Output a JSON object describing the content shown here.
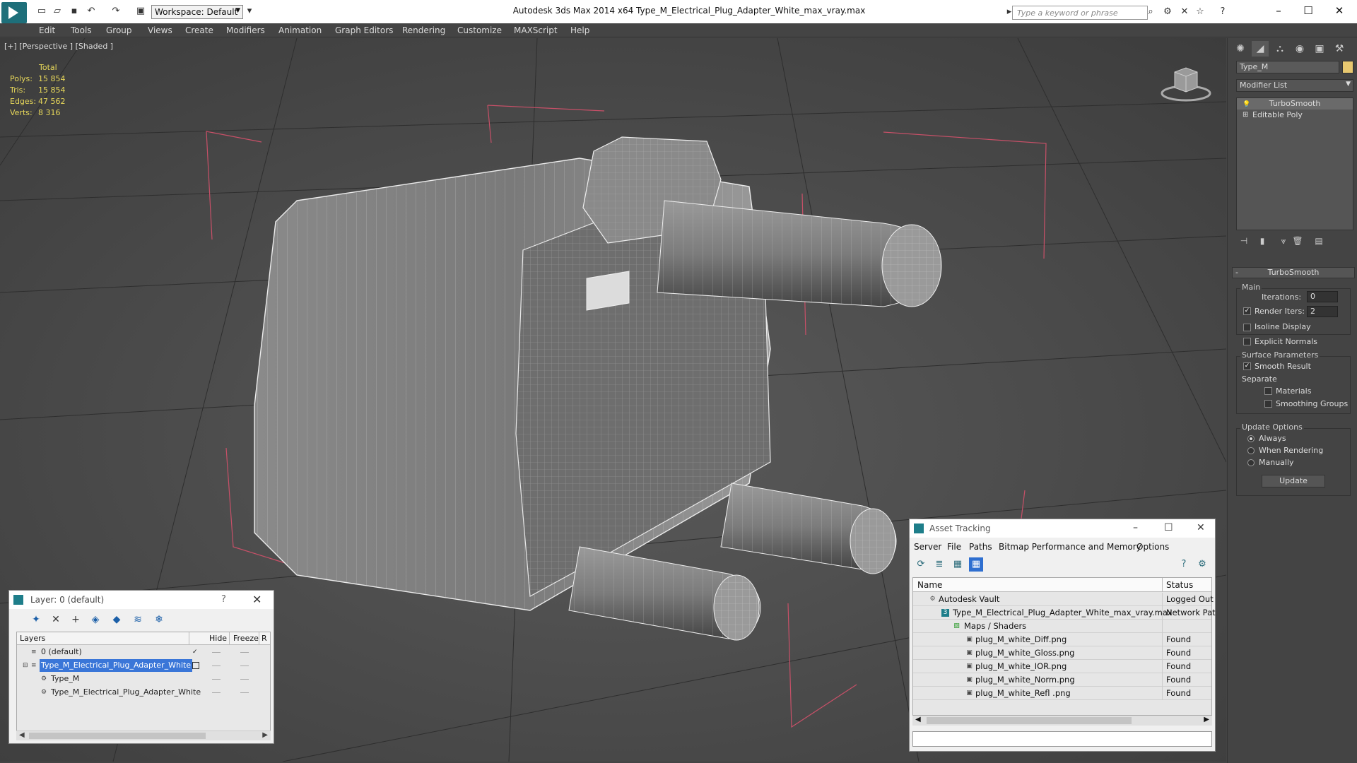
{
  "titlebar": {
    "workspace": "Workspace: Default",
    "title": "Autodesk 3ds Max  2014 x64      Type_M_Electrical_Plug_Adapter_White_max_vray.max",
    "search_placeholder": "Type a keyword or phrase"
  },
  "menu": [
    "Edit",
    "Tools",
    "Group",
    "Views",
    "Create",
    "Modifiers",
    "Animation",
    "Graph Editors",
    "Rendering",
    "Customize",
    "MAXScript",
    "Help"
  ],
  "viewport": {
    "label": "[+] [Perspective ] [Shaded ]",
    "stats": {
      "total": "Total",
      "rows": [
        {
          "label": "Polys:",
          "value": "15 854"
        },
        {
          "label": "Tris:",
          "value": "15 854"
        },
        {
          "label": "Edges:",
          "value": "47 562"
        },
        {
          "label": "Verts:",
          "value": "8 316"
        }
      ]
    }
  },
  "command_panel": {
    "object_name": "Type_M",
    "object_color": "#e8c870",
    "modifier_list": "Modifier List",
    "stack": [
      "TurboSmooth",
      "Editable Poly"
    ],
    "turbosmooth": {
      "title": "TurboSmooth",
      "main": "Main",
      "iterations_label": "Iterations:",
      "iterations_value": "0",
      "render_iters_label": "Render Iters:",
      "render_iters_value": "2",
      "isoline": "Isoline Display",
      "explicit": "Explicit Normals",
      "surface": "Surface Parameters",
      "smooth": "Smooth Result",
      "separate": "Separate",
      "materials": "Materials",
      "smoothing_groups": "Smoothing Groups",
      "update_options": "Update Options",
      "always": "Always",
      "when_rendering": "When Rendering",
      "manually": "Manually",
      "update": "Update"
    }
  },
  "layer_dialog": {
    "title": "Layer: 0 (default)",
    "help": "?",
    "columns": [
      "Layers",
      "Hide",
      "Freeze",
      "R"
    ],
    "rows": [
      {
        "name": "0 (default)"
      },
      {
        "name": "Type_M_Electrical_Plug_Adapter_White"
      },
      {
        "name": "Type_M"
      },
      {
        "name": "Type_M_Electrical_Plug_Adapter_White"
      }
    ]
  },
  "asset_dialog": {
    "title": "Asset Tracking",
    "menu": [
      "Server",
      "File",
      "Paths",
      "Bitmap Performance and Memory",
      "Options"
    ],
    "columns": [
      "Name",
      "Status"
    ],
    "rows": [
      {
        "name": "Autodesk Vault",
        "status": "Logged Out"
      },
      {
        "name": "Type_M_Electrical_Plug_Adapter_White_max_vray.max",
        "status": "Network Pat"
      },
      {
        "name": "Maps / Shaders",
        "status": ""
      },
      {
        "name": "plug_M_white_Diff.png",
        "status": "Found"
      },
      {
        "name": "plug_M_white_Gloss.png",
        "status": "Found"
      },
      {
        "name": "plug_M_white_IOR.png",
        "status": "Found"
      },
      {
        "name": "plug_M_white_Norm.png",
        "status": "Found"
      },
      {
        "name": "plug_M_white_Refl .png",
        "status": "Found"
      }
    ]
  }
}
